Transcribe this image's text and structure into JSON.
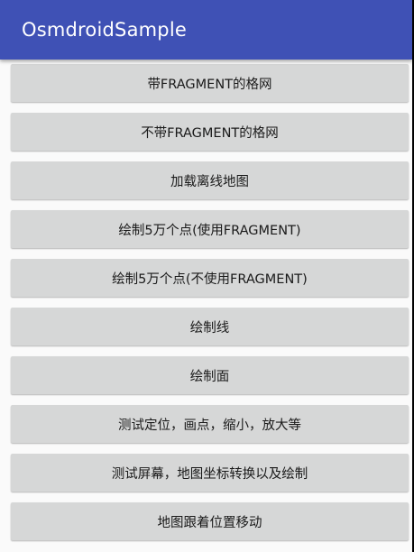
{
  "app_bar": {
    "title": "OsmdroidSample"
  },
  "buttons": [
    "带FRAGMENT的格网",
    "不带FRAGMENT的格网",
    "加载离线地图",
    "绘制5万个点(使用FRAGMENT)",
    "绘制5万个点(不使用FRAGMENT)",
    "绘制线",
    "绘制面",
    "测试定位，画点，缩小，放大等",
    "测试屏幕，地图坐标转换以及绘制",
    "地图跟着位置移动"
  ],
  "colors": {
    "app_bar": "#3f51b5",
    "background": "#fafafa",
    "button": "#d6d7d7"
  }
}
